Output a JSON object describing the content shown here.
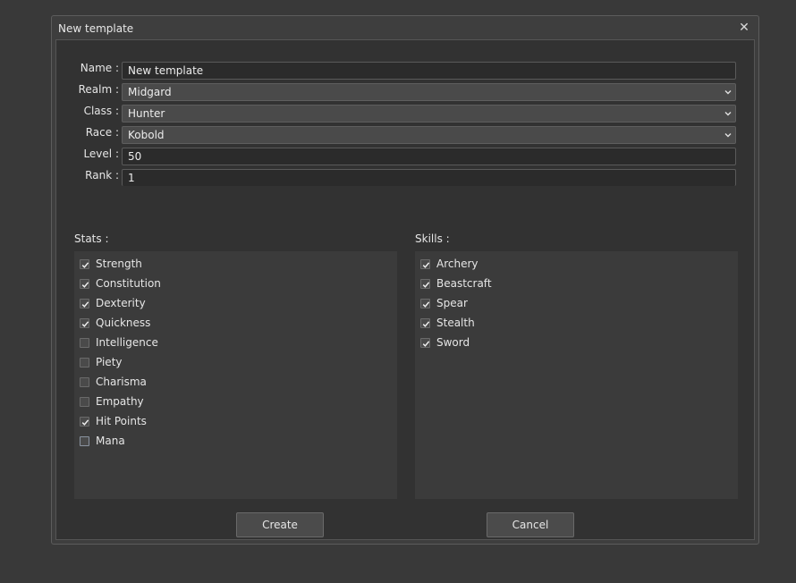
{
  "dialog": {
    "title": "New template",
    "close_glyph": "✕"
  },
  "form": {
    "name": {
      "label": "Name :",
      "value": "New template"
    },
    "realm": {
      "label": "Realm :",
      "value": "Midgard"
    },
    "class": {
      "label": "Class :",
      "value": "Hunter"
    },
    "race": {
      "label": "Race :",
      "value": "Kobold"
    },
    "level": {
      "label": "Level :",
      "value": "50"
    },
    "rank": {
      "label": "Rank :",
      "value": "1"
    }
  },
  "stats": {
    "label": "Stats :",
    "items": [
      {
        "label": "Strength",
        "checked": true
      },
      {
        "label": "Constitution",
        "checked": true
      },
      {
        "label": "Dexterity",
        "checked": true
      },
      {
        "label": "Quickness",
        "checked": true
      },
      {
        "label": "Intelligence",
        "checked": false
      },
      {
        "label": "Piety",
        "checked": false
      },
      {
        "label": "Charisma",
        "checked": false
      },
      {
        "label": "Empathy",
        "checked": false
      },
      {
        "label": "Hit Points",
        "checked": true
      },
      {
        "label": "Mana",
        "checked": false
      }
    ]
  },
  "skills": {
    "label": "Skills :",
    "items": [
      {
        "label": "Archery",
        "checked": true
      },
      {
        "label": "Beastcraft",
        "checked": true
      },
      {
        "label": "Spear",
        "checked": true
      },
      {
        "label": "Stealth",
        "checked": true
      },
      {
        "label": "Sword",
        "checked": true
      }
    ]
  },
  "buttons": {
    "create": "Create",
    "cancel": "Cancel"
  },
  "icons": {
    "close": "close-icon",
    "dropdown": "chevron-down-icon",
    "check": "checkmark-icon"
  }
}
